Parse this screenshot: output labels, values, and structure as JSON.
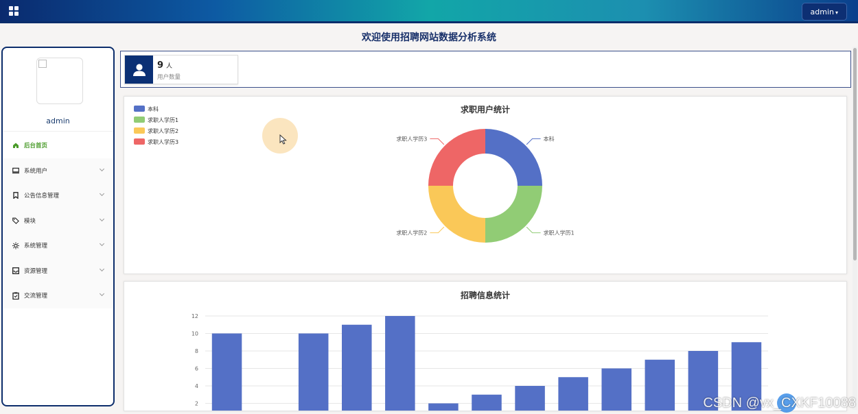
{
  "header": {
    "admin_label": "admin"
  },
  "page_title": "欢迎使用招聘网站数据分析系统",
  "sidebar": {
    "username": "admin",
    "items": [
      {
        "label": "后台首页",
        "icon": "home-icon"
      },
      {
        "label": "系统用户",
        "icon": "monitor-icon"
      },
      {
        "label": "公告信息管理",
        "icon": "bookmark-icon"
      },
      {
        "label": "模块",
        "icon": "tag-icon"
      },
      {
        "label": "系统管理",
        "icon": "sun-gear-icon"
      },
      {
        "label": "资源管理",
        "icon": "inbox-icon"
      },
      {
        "label": "交流管理",
        "icon": "clipboard-icon"
      }
    ]
  },
  "stats": {
    "user_count": "9",
    "user_unit": "人",
    "user_label": "用户数量"
  },
  "colors": {
    "primary_dark": "#0b3075",
    "menu_active": "#4a9b2a",
    "blue": "#5470c6",
    "green": "#91cc75",
    "yellow": "#fac858",
    "red": "#ee6666"
  },
  "watermark": "CSDN @vx_CXKF10088",
  "chart_data": [
    {
      "type": "pie",
      "title": "求职用户统计",
      "categories": [
        "本科",
        "求职人学历1",
        "求职人学历2",
        "求职人学历3"
      ],
      "values": [
        1,
        1,
        1,
        1
      ],
      "colors": [
        "#5470c6",
        "#91cc75",
        "#fac858",
        "#ee6666"
      ],
      "legend": "top-left"
    },
    {
      "type": "bar",
      "title": "招聘信息统计",
      "values": [
        10,
        0,
        10,
        11,
        12,
        2,
        3,
        4,
        5,
        6,
        7,
        8,
        9
      ],
      "yticks": [
        2,
        4,
        6,
        8,
        10,
        12
      ],
      "ylim": [
        0,
        12
      ],
      "color": "#5470c6",
      "grid": true
    }
  ]
}
